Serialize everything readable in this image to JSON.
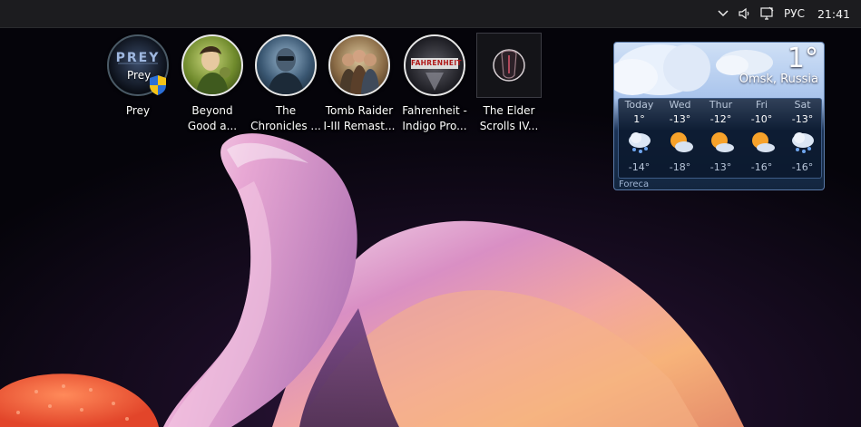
{
  "taskbar": {
    "language": "РУС",
    "time": "21:41"
  },
  "desktop": {
    "icons": [
      {
        "id": "prey",
        "label": "Prey",
        "badge_text": "Prey"
      },
      {
        "id": "beyond-good",
        "label": "Beyond\nGood a..."
      },
      {
        "id": "chronicles",
        "label": "The\nChronicles ..."
      },
      {
        "id": "tomb-raider",
        "label": "Tomb Raider\nI-III Remast..."
      },
      {
        "id": "fahrenheit",
        "label": "Fahrenheit -\nIndigo Pro...",
        "logo_text": "FAHRENHEIT"
      },
      {
        "id": "elder-scrolls",
        "label": "The Elder\nScrolls IV..."
      }
    ]
  },
  "weather": {
    "current_temp": "1°",
    "city": "Omsk, Russia",
    "source": "Foreca",
    "days": [
      {
        "name": "Today",
        "high": "1°",
        "low": "-14°",
        "icon": "snow-cloud-icon"
      },
      {
        "name": "Wed",
        "high": "-13°",
        "low": "-18°",
        "icon": "partly-sunny-icon"
      },
      {
        "name": "Thur",
        "high": "-12°",
        "low": "-13°",
        "icon": "partly-sunny-icon"
      },
      {
        "name": "Fri",
        "high": "-10°",
        "low": "-16°",
        "icon": "partly-sunny-icon"
      },
      {
        "name": "Sat",
        "high": "-13°",
        "low": "-16°",
        "icon": "snow-cloud-icon"
      }
    ]
  }
}
